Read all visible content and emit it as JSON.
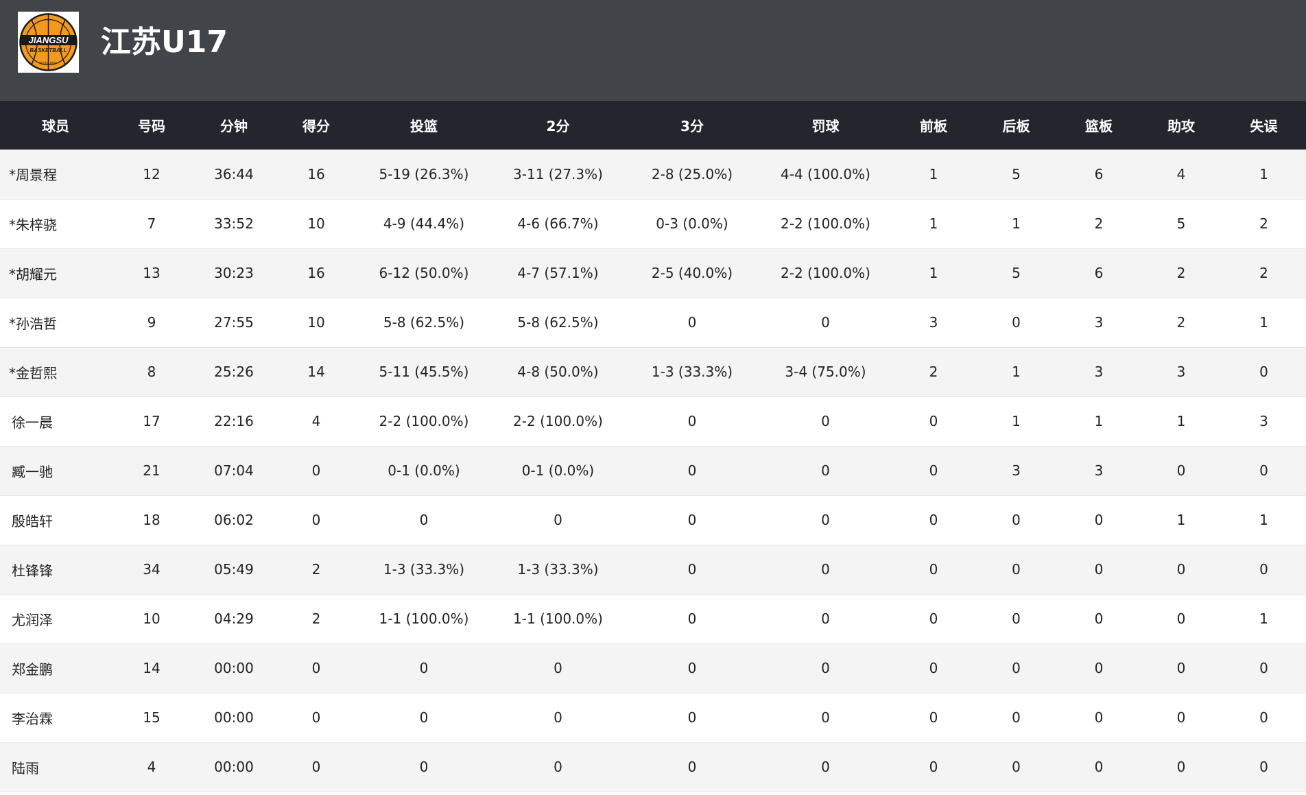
{
  "team": {
    "name": "江苏U17",
    "logo_icon": "jiangsu-basketball-logo",
    "logo_text_top": "JIANGSU",
    "logo_text_bottom": "BASKETBALL",
    "logo_text_est": "ESTD 1957"
  },
  "colors": {
    "header_bg": "#414549",
    "table_header_bg": "#23272d",
    "row_alt_bg": "#f4f4f4",
    "logo_orange": "#f39a1e"
  },
  "columns": [
    "球员",
    "号码",
    "分钟",
    "得分",
    "投篮",
    "2分",
    "3分",
    "罚球",
    "前板",
    "后板",
    "篮板",
    "助攻",
    "失误"
  ],
  "rows": [
    [
      "*周景程",
      "12",
      "36:44",
      "16",
      "5-19 (26.3%)",
      "3-11 (27.3%)",
      "2-8 (25.0%)",
      "4-4 (100.0%)",
      "1",
      "5",
      "6",
      "4",
      "1"
    ],
    [
      "*朱梓骁",
      "7",
      "33:52",
      "10",
      "4-9 (44.4%)",
      "4-6 (66.7%)",
      "0-3 (0.0%)",
      "2-2 (100.0%)",
      "1",
      "1",
      "2",
      "5",
      "2"
    ],
    [
      "*胡耀元",
      "13",
      "30:23",
      "16",
      "6-12 (50.0%)",
      "4-7 (57.1%)",
      "2-5 (40.0%)",
      "2-2 (100.0%)",
      "1",
      "5",
      "6",
      "2",
      "2"
    ],
    [
      "*孙浩哲",
      "9",
      "27:55",
      "10",
      "5-8 (62.5%)",
      "5-8 (62.5%)",
      "0",
      "0",
      "3",
      "0",
      "3",
      "2",
      "1"
    ],
    [
      "*金哲熙",
      "8",
      "25:26",
      "14",
      "5-11 (45.5%)",
      "4-8 (50.0%)",
      "1-3 (33.3%)",
      "3-4 (75.0%)",
      "2",
      "1",
      "3",
      "3",
      "0"
    ],
    [
      "徐一晨",
      "17",
      "22:16",
      "4",
      "2-2 (100.0%)",
      "2-2 (100.0%)",
      "0",
      "0",
      "0",
      "1",
      "1",
      "1",
      "3"
    ],
    [
      "臧一驰",
      "21",
      "07:04",
      "0",
      "0-1 (0.0%)",
      "0-1 (0.0%)",
      "0",
      "0",
      "0",
      "3",
      "3",
      "0",
      "0"
    ],
    [
      "殷皓轩",
      "18",
      "06:02",
      "0",
      "0",
      "0",
      "0",
      "0",
      "0",
      "0",
      "0",
      "1",
      "1"
    ],
    [
      "杜锋锋",
      "34",
      "05:49",
      "2",
      "1-3 (33.3%)",
      "1-3 (33.3%)",
      "0",
      "0",
      "0",
      "0",
      "0",
      "0",
      "0"
    ],
    [
      "尤润泽",
      "10",
      "04:29",
      "2",
      "1-1 (100.0%)",
      "1-1 (100.0%)",
      "0",
      "0",
      "0",
      "0",
      "0",
      "0",
      "1"
    ],
    [
      "郑金鹏",
      "14",
      "00:00",
      "0",
      "0",
      "0",
      "0",
      "0",
      "0",
      "0",
      "0",
      "0",
      "0"
    ],
    [
      "李治霖",
      "15",
      "00:00",
      "0",
      "0",
      "0",
      "0",
      "0",
      "0",
      "0",
      "0",
      "0",
      "0"
    ],
    [
      "陆雨",
      "4",
      "00:00",
      "0",
      "0",
      "0",
      "0",
      "0",
      "0",
      "0",
      "0",
      "0",
      "0"
    ]
  ]
}
